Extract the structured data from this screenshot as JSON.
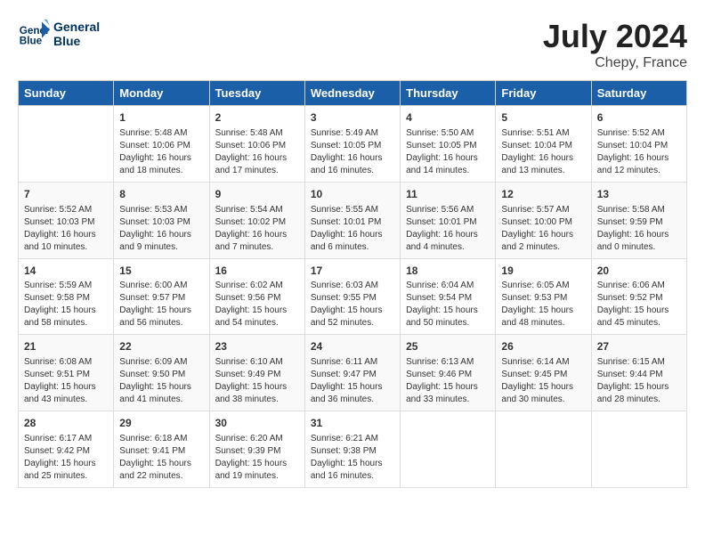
{
  "header": {
    "logo_line1": "General",
    "logo_line2": "Blue",
    "title": "July 2024",
    "subtitle": "Chepy, France"
  },
  "calendar": {
    "weekdays": [
      "Sunday",
      "Monday",
      "Tuesday",
      "Wednesday",
      "Thursday",
      "Friday",
      "Saturday"
    ],
    "weeks": [
      [
        {
          "day": "",
          "info": ""
        },
        {
          "day": "1",
          "info": "Sunrise: 5:48 AM\nSunset: 10:06 PM\nDaylight: 16 hours\nand 18 minutes."
        },
        {
          "day": "2",
          "info": "Sunrise: 5:48 AM\nSunset: 10:06 PM\nDaylight: 16 hours\nand 17 minutes."
        },
        {
          "day": "3",
          "info": "Sunrise: 5:49 AM\nSunset: 10:05 PM\nDaylight: 16 hours\nand 16 minutes."
        },
        {
          "day": "4",
          "info": "Sunrise: 5:50 AM\nSunset: 10:05 PM\nDaylight: 16 hours\nand 14 minutes."
        },
        {
          "day": "5",
          "info": "Sunrise: 5:51 AM\nSunset: 10:04 PM\nDaylight: 16 hours\nand 13 minutes."
        },
        {
          "day": "6",
          "info": "Sunrise: 5:52 AM\nSunset: 10:04 PM\nDaylight: 16 hours\nand 12 minutes."
        }
      ],
      [
        {
          "day": "7",
          "info": "Sunrise: 5:52 AM\nSunset: 10:03 PM\nDaylight: 16 hours\nand 10 minutes."
        },
        {
          "day": "8",
          "info": "Sunrise: 5:53 AM\nSunset: 10:03 PM\nDaylight: 16 hours\nand 9 minutes."
        },
        {
          "day": "9",
          "info": "Sunrise: 5:54 AM\nSunset: 10:02 PM\nDaylight: 16 hours\nand 7 minutes."
        },
        {
          "day": "10",
          "info": "Sunrise: 5:55 AM\nSunset: 10:01 PM\nDaylight: 16 hours\nand 6 minutes."
        },
        {
          "day": "11",
          "info": "Sunrise: 5:56 AM\nSunset: 10:01 PM\nDaylight: 16 hours\nand 4 minutes."
        },
        {
          "day": "12",
          "info": "Sunrise: 5:57 AM\nSunset: 10:00 PM\nDaylight: 16 hours\nand 2 minutes."
        },
        {
          "day": "13",
          "info": "Sunrise: 5:58 AM\nSunset: 9:59 PM\nDaylight: 16 hours\nand 0 minutes."
        }
      ],
      [
        {
          "day": "14",
          "info": "Sunrise: 5:59 AM\nSunset: 9:58 PM\nDaylight: 15 hours\nand 58 minutes."
        },
        {
          "day": "15",
          "info": "Sunrise: 6:00 AM\nSunset: 9:57 PM\nDaylight: 15 hours\nand 56 minutes."
        },
        {
          "day": "16",
          "info": "Sunrise: 6:02 AM\nSunset: 9:56 PM\nDaylight: 15 hours\nand 54 minutes."
        },
        {
          "day": "17",
          "info": "Sunrise: 6:03 AM\nSunset: 9:55 PM\nDaylight: 15 hours\nand 52 minutes."
        },
        {
          "day": "18",
          "info": "Sunrise: 6:04 AM\nSunset: 9:54 PM\nDaylight: 15 hours\nand 50 minutes."
        },
        {
          "day": "19",
          "info": "Sunrise: 6:05 AM\nSunset: 9:53 PM\nDaylight: 15 hours\nand 48 minutes."
        },
        {
          "day": "20",
          "info": "Sunrise: 6:06 AM\nSunset: 9:52 PM\nDaylight: 15 hours\nand 45 minutes."
        }
      ],
      [
        {
          "day": "21",
          "info": "Sunrise: 6:08 AM\nSunset: 9:51 PM\nDaylight: 15 hours\nand 43 minutes."
        },
        {
          "day": "22",
          "info": "Sunrise: 6:09 AM\nSunset: 9:50 PM\nDaylight: 15 hours\nand 41 minutes."
        },
        {
          "day": "23",
          "info": "Sunrise: 6:10 AM\nSunset: 9:49 PM\nDaylight: 15 hours\nand 38 minutes."
        },
        {
          "day": "24",
          "info": "Sunrise: 6:11 AM\nSunset: 9:47 PM\nDaylight: 15 hours\nand 36 minutes."
        },
        {
          "day": "25",
          "info": "Sunrise: 6:13 AM\nSunset: 9:46 PM\nDaylight: 15 hours\nand 33 minutes."
        },
        {
          "day": "26",
          "info": "Sunrise: 6:14 AM\nSunset: 9:45 PM\nDaylight: 15 hours\nand 30 minutes."
        },
        {
          "day": "27",
          "info": "Sunrise: 6:15 AM\nSunset: 9:44 PM\nDaylight: 15 hours\nand 28 minutes."
        }
      ],
      [
        {
          "day": "28",
          "info": "Sunrise: 6:17 AM\nSunset: 9:42 PM\nDaylight: 15 hours\nand 25 minutes."
        },
        {
          "day": "29",
          "info": "Sunrise: 6:18 AM\nSunset: 9:41 PM\nDaylight: 15 hours\nand 22 minutes."
        },
        {
          "day": "30",
          "info": "Sunrise: 6:20 AM\nSunset: 9:39 PM\nDaylight: 15 hours\nand 19 minutes."
        },
        {
          "day": "31",
          "info": "Sunrise: 6:21 AM\nSunset: 9:38 PM\nDaylight: 15 hours\nand 16 minutes."
        },
        {
          "day": "",
          "info": ""
        },
        {
          "day": "",
          "info": ""
        },
        {
          "day": "",
          "info": ""
        }
      ]
    ]
  }
}
